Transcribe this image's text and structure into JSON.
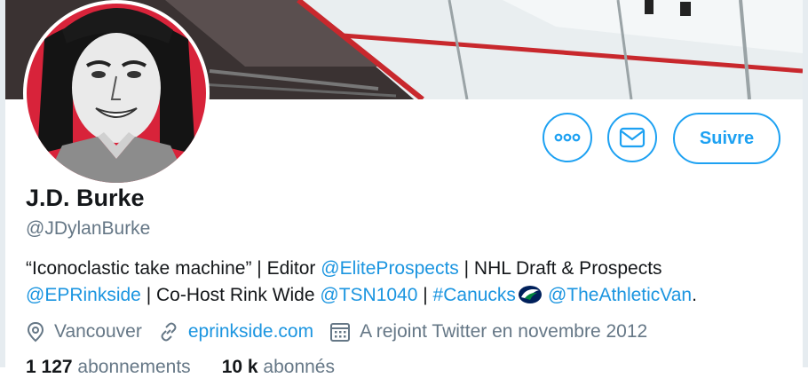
{
  "profile": {
    "name": "J.D. Burke",
    "handle": "@JDylanBurke",
    "bio": {
      "line1_text1": "“Iconoclastic take machine” | Editor ",
      "line1_link1": "@EliteProspects",
      "line1_text2": " | NHL Draft & Prospects",
      "line2_link1": "@EPRinkside",
      "line2_text1": " | Co-Host Rink Wide ",
      "line2_link2": "@TSN1040",
      "line2_text2": " | ",
      "line2_link3": "#Canucks",
      "line2_link4": "@TheAthleticVan",
      "line2_text3": "."
    },
    "location": "Vancouver",
    "website": "eprinkside.com",
    "joined": "A rejoint Twitter en novembre 2012",
    "stats": {
      "following_count": "1 127",
      "following_label": "abonnements",
      "followers_count": "10 k",
      "followers_label": "abonnés"
    }
  },
  "actions": {
    "more_icon": "ellipsis-icon",
    "message_icon": "envelope-icon",
    "follow_label": "Suivre"
  },
  "colors": {
    "accent": "#1da1f2",
    "link": "#1b95e0",
    "secondary_text": "#657786",
    "primary_text": "#14171a"
  }
}
